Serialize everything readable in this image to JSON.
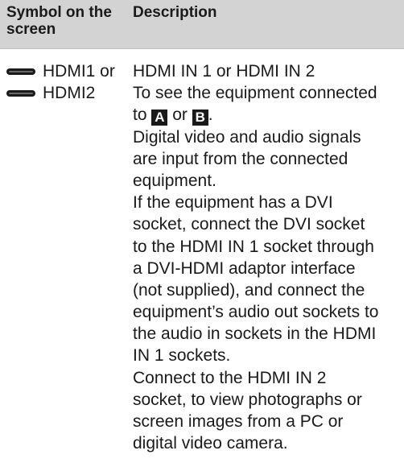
{
  "table": {
    "headers": {
      "symbol": "Symbol on the screen",
      "description": "Description"
    },
    "symbols": [
      {
        "icon": "hdmi-connector-icon",
        "label": "HDMI1 or"
      },
      {
        "icon": "hdmi-connector-icon",
        "label": "HDMI2"
      }
    ],
    "description": {
      "title": "HDMI IN 1 or HDMI IN 2",
      "connect_to": {
        "prefix": "To see the equipment connected",
        "to": "to",
        "badge_a": "A",
        "or": "or",
        "badge_b": "B",
        "end": "."
      },
      "lines": [
        "Digital video and audio signals",
        "are input from the connected",
        "equipment.",
        "If the equipment has a DVI",
        "socket, connect the DVI socket",
        "to the HDMI IN 1 socket through",
        "a DVI-HDMI adaptor interface",
        "(not supplied), and connect the",
        "equipment’s audio out sockets to",
        "the audio in sockets in the HDMI",
        "IN 1 sockets.",
        "Connect to the HDMI IN 2",
        "socket, to view photographs or",
        "screen images from a PC or",
        "digital video camera."
      ]
    }
  }
}
